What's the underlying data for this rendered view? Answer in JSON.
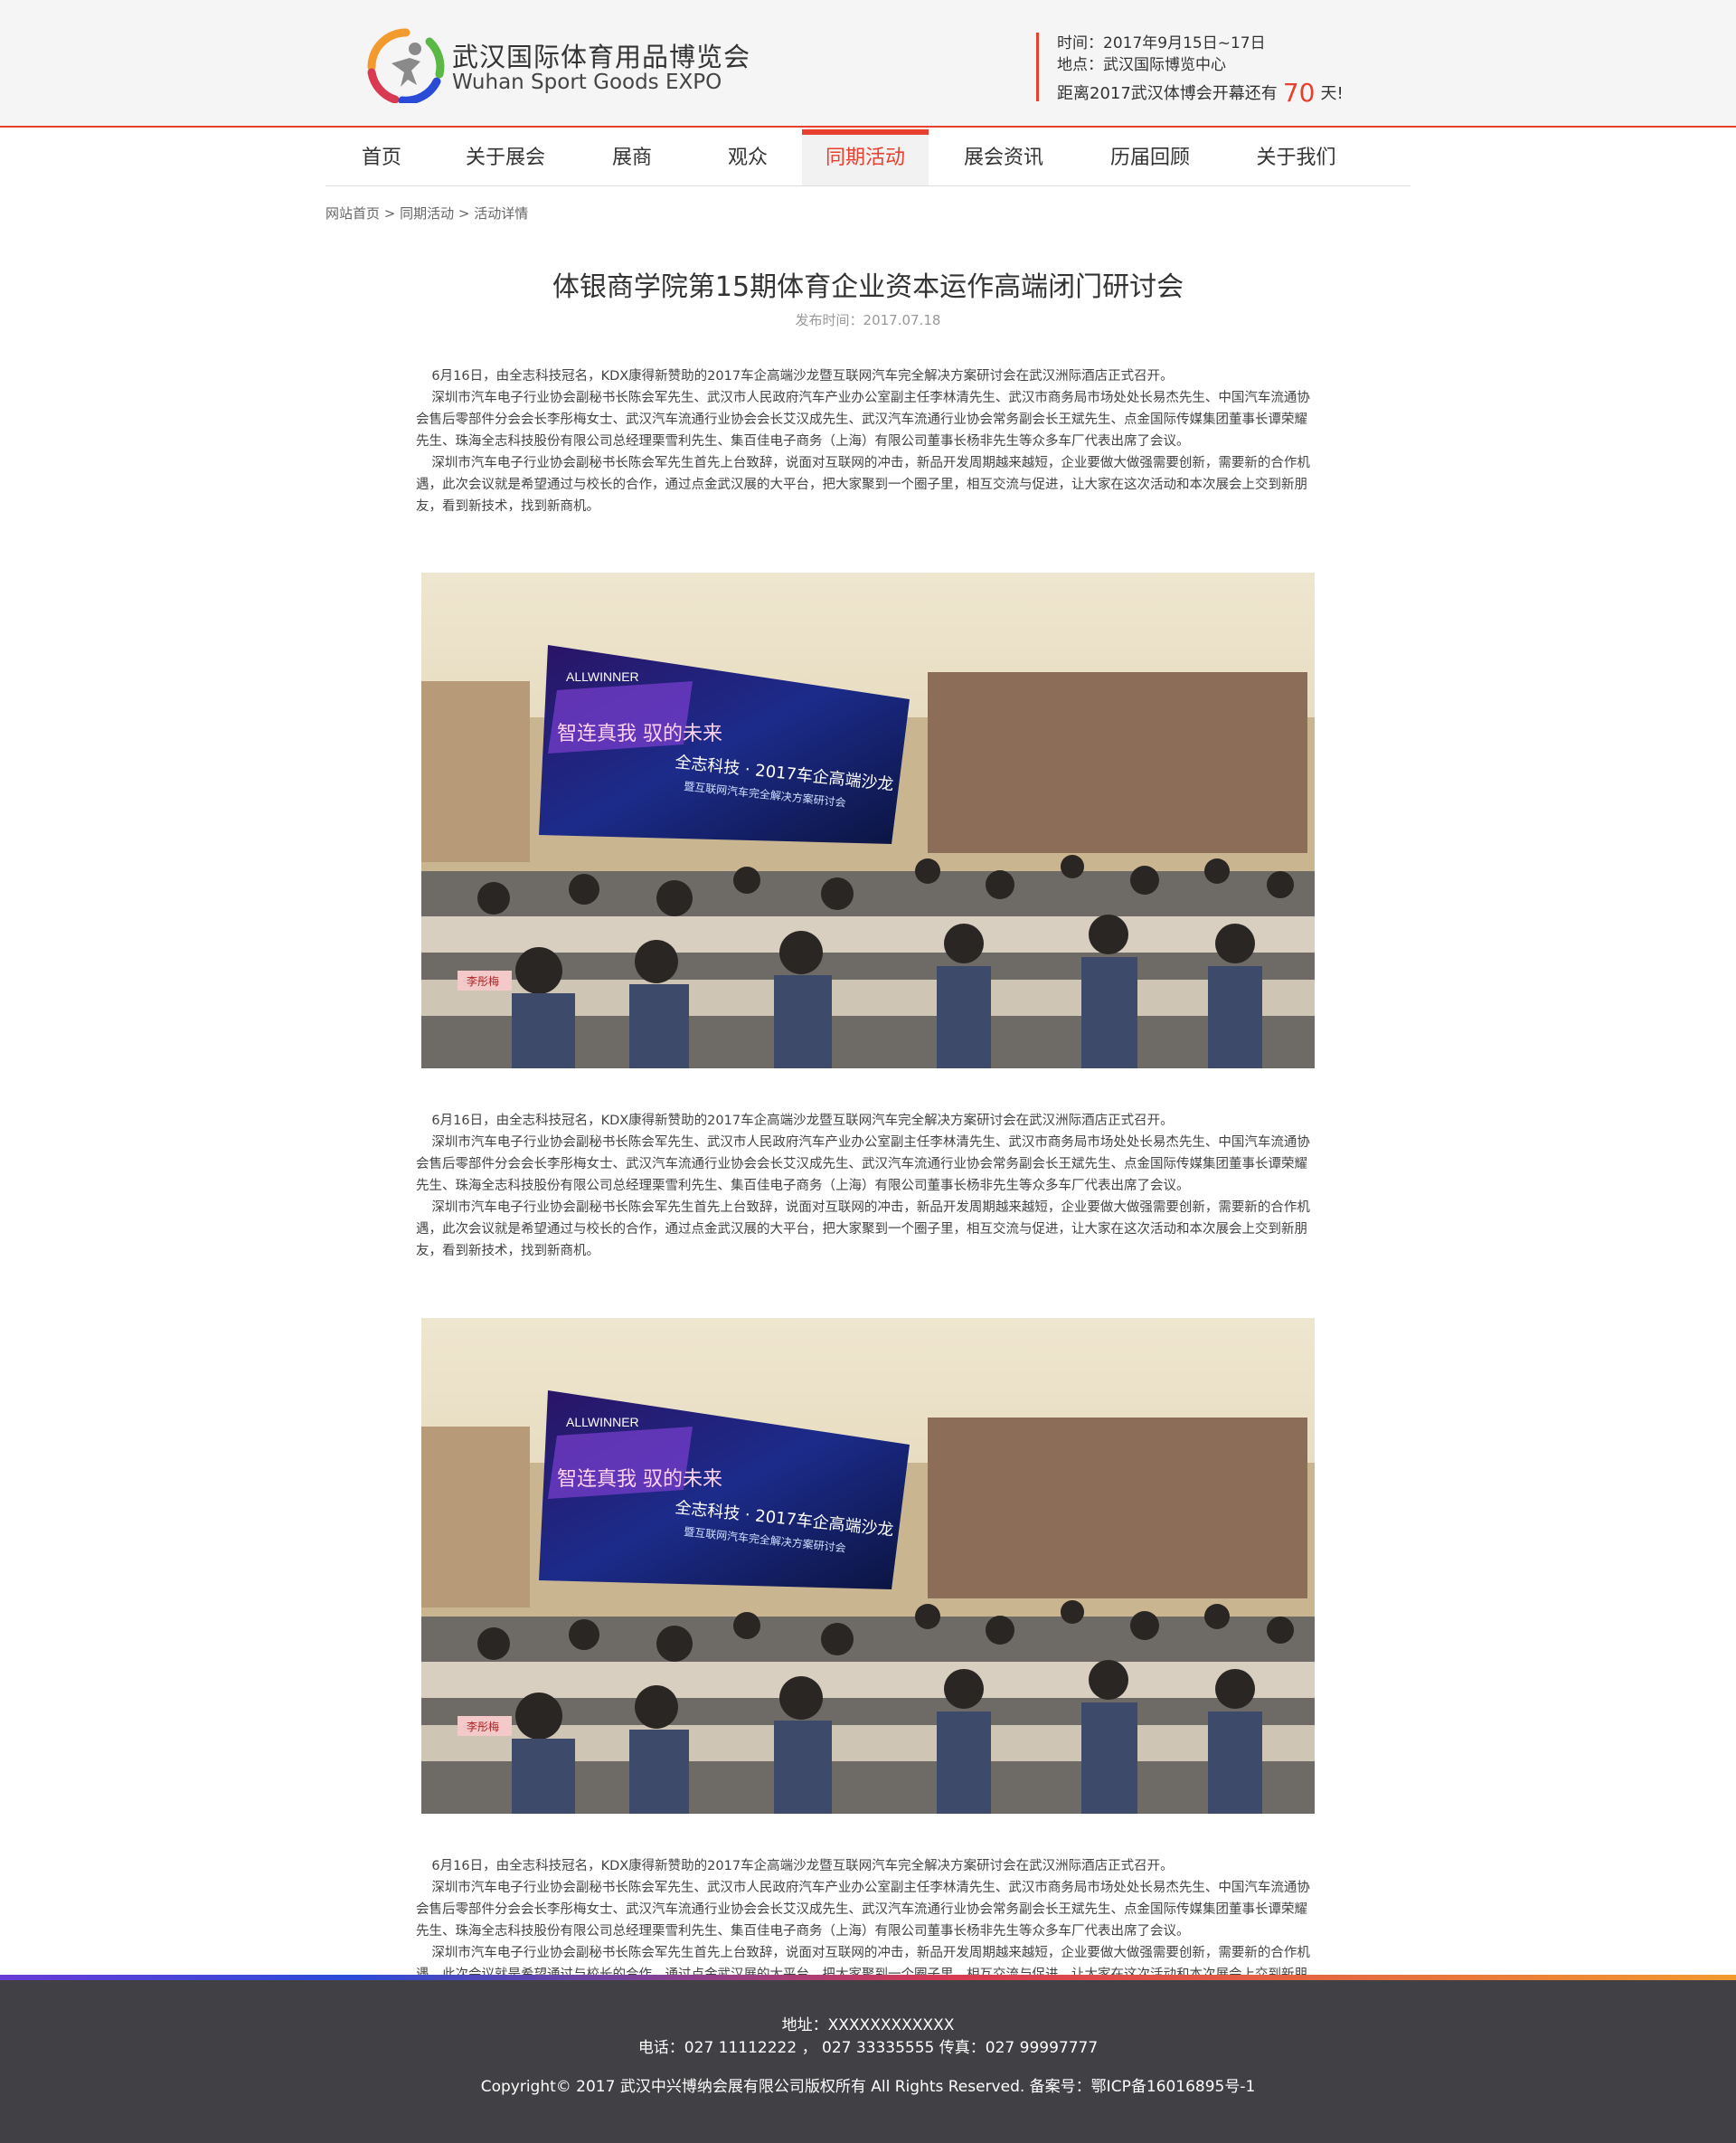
{
  "header": {
    "brand_cn": "武汉国际体育用品博览会",
    "brand_en": "Wuhan Sport Goods EXPO",
    "time_label": "时间：2017年9月15日~17日",
    "place_label": "地点：武汉国际博览中心",
    "countdown_prefix": "距离2017武汉体博会开幕还有",
    "countdown_days": "70",
    "countdown_suffix": "天!"
  },
  "nav": {
    "items": [
      "首页",
      "关于展会",
      "展商",
      "观众",
      "同期活动",
      "展会资讯",
      "历届回顾",
      "关于我们"
    ],
    "active": "同期活动"
  },
  "breadcrumb": {
    "home": "网站首页",
    "sep1": " > ",
    "section": "同期活动",
    "sep2": " > ",
    "current": "活动详情"
  },
  "article": {
    "title": "体银商学院第15期体育企业资本运作高端闭门研讨会",
    "date": "发布时间：2017.07.18",
    "p1": "6月16日，由全志科技冠名，KDX康得新赞助的2017车企高端沙龙暨互联网汽车完全解决方案研讨会在武汉洲际酒店正式召开。",
    "p2": "深圳市汽车电子行业协会副秘书长陈会军先生、武汉市人民政府汽车产业办公室副主任李林清先生、武汉市商务局市场处处长易杰先生、中国汽车流通协会售后零部件分会会长李彤梅女士、武汉汽车流通行业协会会长艾汉成先生、武汉汽车流通行业协会常务副会长王斌先生、点金国际传媒集团董事长谭荣耀先生、珠海全志科技股份有限公司总经理栗雪利先生、集百佳电子商务（上海）有限公司董事长杨非先生等众多车厂代表出席了会议。",
    "p3": "深圳市汽车电子行业协会副秘书长陈会军先生首先上台致辞，说面对互联网的冲击，新品开发周期越来越短，企业要做大做强需要创新，需要新的合作机遇，此次会议就是希望通过与校长的合作，通过点金武汉展的大平台，把大家聚到一个圈子里，相互交流与促进，让大家在这次活动和本次展会上交到新朋友，看到新技术，找到新商机。",
    "photo_screen_text": "全志科技 · 2017车企高端沙龙",
    "photo_screen_sub": "暨互联网汽车完全解决方案研讨会",
    "photo_screen_left": "智连真我 驭的未来",
    "photo_logo": "ALLWINNER",
    "photo_nameplate": "李彤梅"
  },
  "footer": {
    "address": "地址：XXXXXXXXXXXX",
    "phone": "电话：027 11112222 ，  027 33335555 传真：027 99997777",
    "copyright": "Copyright© 2017 武汉中兴博纳会展有限公司版权所有 All Rights Reserved.  备案号：鄂ICP备16016895号-1"
  },
  "colors": {
    "accent": "#e8402e",
    "footer_bg": "#414145"
  }
}
